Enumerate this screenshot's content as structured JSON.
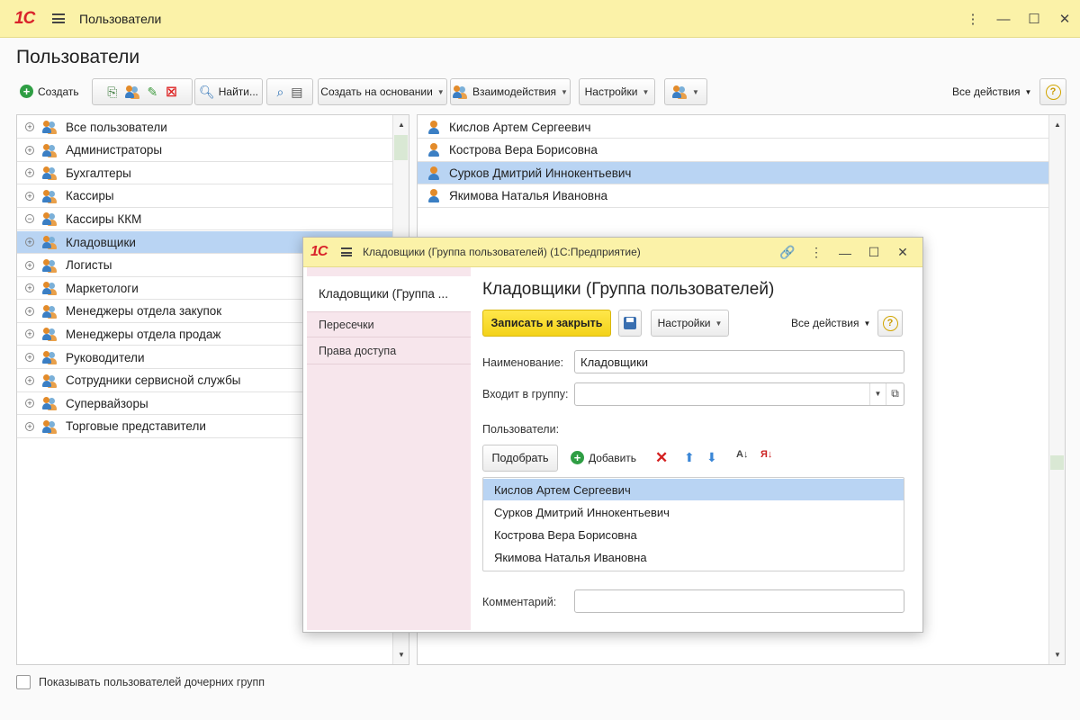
{
  "window": {
    "logo": "1С",
    "title": "Пользователи",
    "controls": [
      "⋮",
      "—",
      "☐",
      "✕"
    ]
  },
  "page_title": "Пользователи",
  "toolbar": {
    "create_label": "Создать",
    "find_label": "Найти...",
    "create_based_label": "Создать на основании",
    "interactions_label": "Взаимодействия",
    "settings_label": "Настройки",
    "all_actions_label": "Все действия",
    "help_symbol": "?"
  },
  "groups": [
    {
      "label": "Все пользователи",
      "expander": "+"
    },
    {
      "label": "Администраторы",
      "expander": "+"
    },
    {
      "label": "Бухгалтеры",
      "expander": "+"
    },
    {
      "label": "Кассиры",
      "expander": "+"
    },
    {
      "label": "Кассиры ККМ",
      "expander": "−"
    },
    {
      "label": "Кладовщики",
      "expander": "+",
      "selected": true
    },
    {
      "label": "Логисты",
      "expander": "+"
    },
    {
      "label": "Маркетологи",
      "expander": "+"
    },
    {
      "label": "Менеджеры отдела закупок",
      "expander": "+"
    },
    {
      "label": "Менеджеры отдела продаж",
      "expander": "+"
    },
    {
      "label": "Руководители",
      "expander": "+"
    },
    {
      "label": "Сотрудники сервисной службы",
      "expander": "+"
    },
    {
      "label": "Супервайзоры",
      "expander": "+"
    },
    {
      "label": "Торговые представители",
      "expander": "+"
    }
  ],
  "users": [
    {
      "name": "Кислов Артем Сергеевич"
    },
    {
      "name": "Кострова Вера Борисовна"
    },
    {
      "name": "Сурков Дмитрий Иннокентьевич",
      "selected": true
    },
    {
      "name": "Якимова Наталья Ивановна"
    }
  ],
  "show_child_groups_label": "Показывать пользователей дочерних групп",
  "dialog": {
    "logo": "1С",
    "title": "Кладовщики (Группа пользователей)  (1С:Предприятие)",
    "controls": [
      "🔗",
      "⋮",
      "—",
      "☐",
      "✕"
    ],
    "nav": [
      {
        "label": "Кладовщики (Группа ...",
        "active": true
      },
      {
        "label": "Пересечки"
      },
      {
        "label": "Права доступа"
      }
    ],
    "heading": "Кладовщики (Группа пользователей)",
    "save_close_label": "Записать и закрыть",
    "settings_label": "Настройки",
    "all_actions_label": "Все действия",
    "help_symbol": "?",
    "name_label": "Наименование:",
    "name_value": "Кладовщики",
    "parent_label": "Входит в группу:",
    "parent_value": "",
    "users_label": "Пользователи:",
    "pick_label": "Подобрать",
    "add_label": "Добавить",
    "members": [
      {
        "name": "Кислов Артем Сергеевич",
        "selected": true
      },
      {
        "name": "Сурков Дмитрий Иннокентьевич"
      },
      {
        "name": "Кострова Вера Борисовна"
      },
      {
        "name": "Якимова Наталья Ивановна"
      }
    ],
    "comment_label": "Комментарий:",
    "comment_value": ""
  }
}
